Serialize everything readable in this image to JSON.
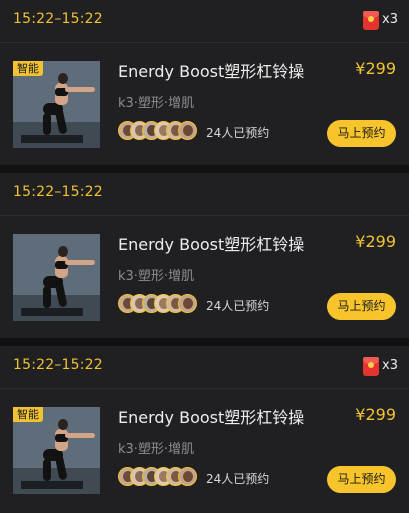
{
  "classes": [
    {
      "time": "15:22–15:22",
      "has_redpack": true,
      "redpack_icon": "red-envelope-icon",
      "redpack_multiplier": "x3",
      "badge": "智能",
      "title": "Enerdy Boost塑形杠铃操",
      "price": "¥299",
      "tags": "k3·塑形·增肌",
      "booked": "24人已预约",
      "button": "马上预约"
    },
    {
      "time": "15:22–15:22",
      "has_redpack": false,
      "badge": "",
      "title": "Enerdy Boost塑形杠铃操",
      "price": "¥299",
      "tags": "k3·塑形·增肌",
      "booked": "24人已预约",
      "button": "马上预约"
    },
    {
      "time": "15:22–15:22",
      "has_redpack": true,
      "redpack_icon": "red-envelope-icon",
      "redpack_multiplier": "x3",
      "badge": "智能",
      "title": "Enerdy Boost塑形杠铃操",
      "price": "¥299",
      "tags": "k3·塑形·增肌",
      "booked": "24人已预约",
      "button": "马上预约"
    }
  ],
  "colors": {
    "accent": "#f1c232",
    "button": "#f7c52b",
    "card_bg": "#202022",
    "page_bg": "#111112"
  }
}
